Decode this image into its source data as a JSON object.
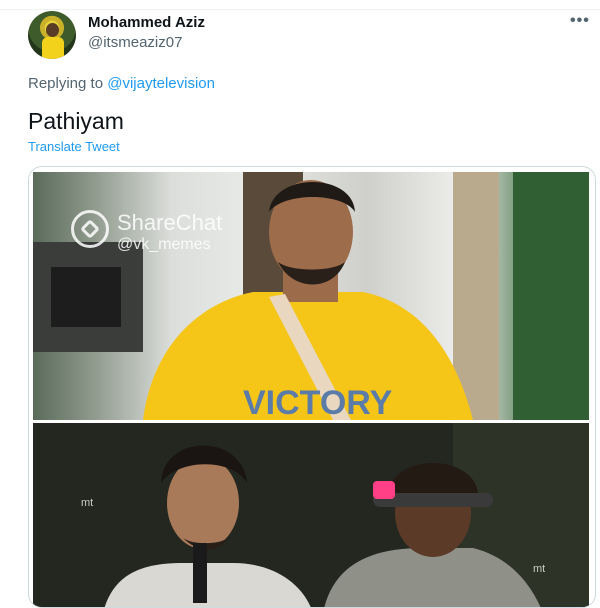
{
  "tweet": {
    "author_name": "Mohammed Aziz",
    "author_handle": "@itsmeaziz07",
    "more_icon": "more-dots-icon",
    "reply_prefix": "Replying to",
    "reply_mention": "@vijaytelevision",
    "text": "Pathiyam",
    "translate_label": "Translate Tweet"
  },
  "media": {
    "watermark_title": "ShareChat",
    "watermark_handle": "@vk_memes",
    "shirt_text": "VICTORY",
    "bottom_mark_left": "mt",
    "bottom_mark_right": "mt"
  },
  "colors": {
    "link": "#1d9bf0",
    "secondary_text": "#536471",
    "shirt": "#f5c518"
  }
}
